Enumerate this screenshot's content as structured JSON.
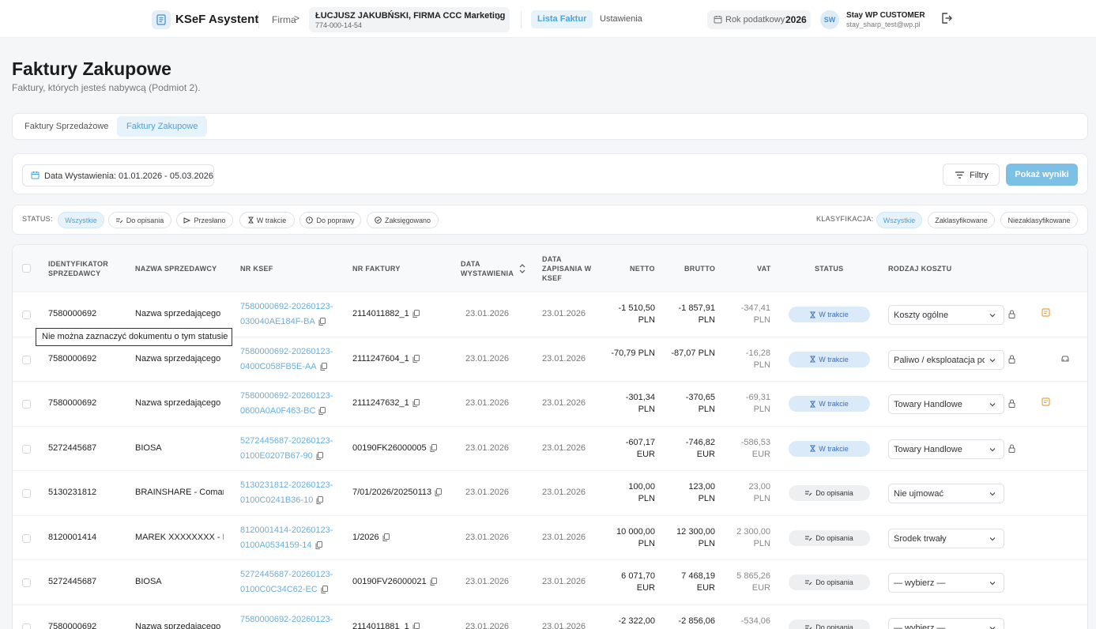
{
  "header": {
    "app_name": "KSeF Asystent",
    "firma_label": "Firma",
    "firma_arrow": ">",
    "firma_name": "ŁUCJUSZ JAKUBŃSKI, FIRMA CCC Marketing",
    "firma_nip": "774-000-14-54",
    "nav_active": "Lista Faktur",
    "nav_settings": "Ustawienia",
    "year_label": "Rok podatkowy",
    "year_value": "2026",
    "user_initials": "SW",
    "user_name": "Stay WP CUSTOMER",
    "user_email": "stay_sharp_test@wp.pl"
  },
  "page": {
    "title": "Faktury Zakupowe",
    "subtitle": "Faktury, których jesteś nabywcą (Podmiot 2)."
  },
  "tabs": {
    "sales": "Faktury Sprzedażowe",
    "purchase": "Faktury Zakupowe"
  },
  "filter": {
    "date_range": "Data Wystawienia: 01.01.2026 - 05.03.2026",
    "filtry": "Filtry",
    "show": "Pokaż wyniki"
  },
  "status_filter": {
    "label": "STATUS:",
    "all": "Wszystkie",
    "do_opisania": "Do opisania",
    "przeslano": "Przesłano",
    "w_trakcie": "W trakcie",
    "do_poprawy": "Do poprawy",
    "zaksiegowano": "Zaksięgowano"
  },
  "class_filter": {
    "label": "KLASYFIKACJA:",
    "all": "Wszystkie",
    "classified": "Zaklasyfikowane",
    "unclassified": "Niezaklasyfikowane"
  },
  "table": {
    "headers": {
      "seller_id": [
        "IDENTYFIKATOR",
        "SPRZEDAWCY"
      ],
      "seller_name": "NAZWA SPRZEDAWCY",
      "ksef": "NR KSEF",
      "invoice": "NR FAKTURY",
      "issue_date": [
        "DATA",
        "WYSTAWIENIA"
      ],
      "save_date": [
        "DATA",
        "ZAPISANIA W",
        "KSEF"
      ],
      "netto": "NETTO",
      "brutto": "BRUTTO",
      "vat": "VAT",
      "status": "STATUS",
      "cost_type": "RODZAJ KOSZTU"
    },
    "rows": [
      {
        "id": "7580000692",
        "name": "Nazwa sprzedającego",
        "ksef1": "7580000692-20260123-",
        "ksef2": "030040AE184F-BA",
        "invoice": "2114011882_1",
        "issue": "23.01.2026",
        "saved": "23.01.2026",
        "netto1": "-1 510,50",
        "netto2": "PLN",
        "brutto1": "-1 857,91",
        "brutto2": "PLN",
        "vat1": "-347,41",
        "vat2": "PLN",
        "status": "W trakcie",
        "cost": "Koszty ogólne"
      },
      {
        "id": "7580000692",
        "name": "Nazwa sprzedającego",
        "ksef1": "7580000692-20260123-",
        "ksef2": "0400C058FB5E-AA",
        "invoice": "2111247604_1",
        "issue": "23.01.2026",
        "saved": "23.01.2026",
        "netto1": "-70,79 PLN",
        "netto2": "",
        "brutto1": "-87,07 PLN",
        "brutto2": "",
        "vat1": "-16,28",
        "vat2": "PLN",
        "status": "W trakcie",
        "cost": "Paliwo / eksploatacja po"
      },
      {
        "id": "7580000692",
        "name": "Nazwa sprzedającego",
        "ksef1": "7580000692-20260123-",
        "ksef2": "0600A0A0F463-BC",
        "invoice": "2111247632_1",
        "issue": "23.01.2026",
        "saved": "23.01.2026",
        "netto1": "-301,34",
        "netto2": "PLN",
        "brutto1": "-370,65",
        "brutto2": "PLN",
        "vat1": "-69,31",
        "vat2": "PLN",
        "status": "W trakcie",
        "cost": "Towary Handlowe"
      },
      {
        "id": "5272445687",
        "name": "BIOSA",
        "ksef1": "5272445687-20260123-",
        "ksef2": "0100E0207B67-90",
        "invoice": "00190FK26000005",
        "issue": "23.01.2026",
        "saved": "23.01.2026",
        "netto1": "-607,17",
        "netto2": "EUR",
        "brutto1": "-746,82",
        "brutto2": "EUR",
        "vat1": "-586,53",
        "vat2": "EUR",
        "status": "W trakcie",
        "cost": "Towary Handlowe"
      },
      {
        "id": "5130231812",
        "name": "BRAINSHARE - Comar...",
        "ksef1": "5130231812-20260123-",
        "ksef2": "0100C0241B36-10",
        "invoice": "7/01/2026/20250113",
        "issue": "23.01.2026",
        "saved": "23.01.2026",
        "netto1": "100,00",
        "netto2": "PLN",
        "brutto1": "123,00",
        "brutto2": "PLN",
        "vat1": "23,00",
        "vat2": "PLN",
        "status": "Do opisania",
        "cost": "Nie ujmować"
      },
      {
        "id": "8120001414",
        "name": "MAREK XXXXXXXX - P...",
        "ksef1": "8120001414-20260123-",
        "ksef2": "0100A0534159-14",
        "invoice": "1/2026",
        "issue": "23.01.2026",
        "saved": "23.01.2026",
        "netto1": "10 000,00",
        "netto2": "PLN",
        "brutto1": "12 300,00",
        "brutto2": "PLN",
        "vat1": "2 300,00",
        "vat2": "PLN",
        "status": "Do opisania",
        "cost": "Środek trwały"
      },
      {
        "id": "5272445687",
        "name": "BIOSA",
        "ksef1": "5272445687-20260123-",
        "ksef2": "0100C0C34C62-EC",
        "invoice": "00190FV26000021",
        "issue": "23.01.2026",
        "saved": "23.01.2026",
        "netto1": "6 071,70",
        "netto2": "EUR",
        "brutto1": "7 468,19",
        "brutto2": "EUR",
        "vat1": "5 865,26",
        "vat2": "EUR",
        "status": "Do opisania",
        "cost": "— wybierz —"
      },
      {
        "id": "7580000692",
        "name": "Nazwa sprzedającego",
        "ksef1": "7580000692-20260123-",
        "ksef2": "",
        "invoice": "2114011881_1",
        "issue": "23.01.2026",
        "saved": "23.01.2026",
        "netto1": "-2 322,00",
        "netto2": "",
        "brutto1": "-2 856,06",
        "brutto2": "",
        "vat1": "-534,06",
        "vat2": "",
        "status": "Do opisania",
        "cost": "— wybierz —"
      }
    ]
  },
  "tooltip": "Nie można zaznaczyć dokumentu o tym statusie",
  "colors": {
    "accent": "#4aa3df",
    "ksef_link": "#6aaedb",
    "note_icon": "#e8a33d"
  }
}
